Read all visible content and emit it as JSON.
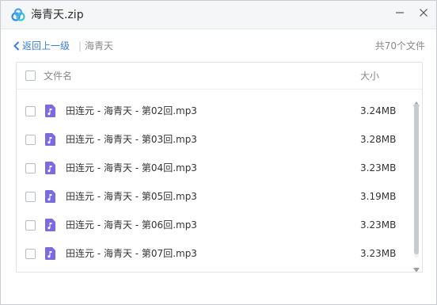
{
  "window": {
    "title": "海青天.zip",
    "logo_icon": "baidu-netdisk-cloud-icon",
    "minimize_icon": "minimize-icon",
    "close_icon": "close-icon"
  },
  "breadcrumb": {
    "back_label": "返回上一级",
    "separator": "|",
    "current": "海青天",
    "file_count": "共70个文件"
  },
  "list": {
    "columns": {
      "name": "文件名",
      "size": "大小"
    },
    "rows": [
      {
        "name": "田连元 - 海青天 - 第02回.mp3",
        "size": "3.24MB"
      },
      {
        "name": "田连元 - 海青天 - 第03回.mp3",
        "size": "3.28MB"
      },
      {
        "name": "田连元 - 海青天 - 第04回.mp3",
        "size": "3.23MB"
      },
      {
        "name": "田连元 - 海青天 - 第05回.mp3",
        "size": "3.19MB"
      },
      {
        "name": "田连元 - 海青天 - 第06回.mp3",
        "size": "3.23MB"
      },
      {
        "name": "田连元 - 海青天 - 第07回.mp3",
        "size": "3.23MB"
      }
    ],
    "file_icon": "audio-file-icon"
  },
  "colors": {
    "accent": "#3a7de0",
    "audio_icon": "#7b6be0",
    "logo_blue": "#2f8bf0",
    "logo_teal": "#3cc8c8"
  }
}
